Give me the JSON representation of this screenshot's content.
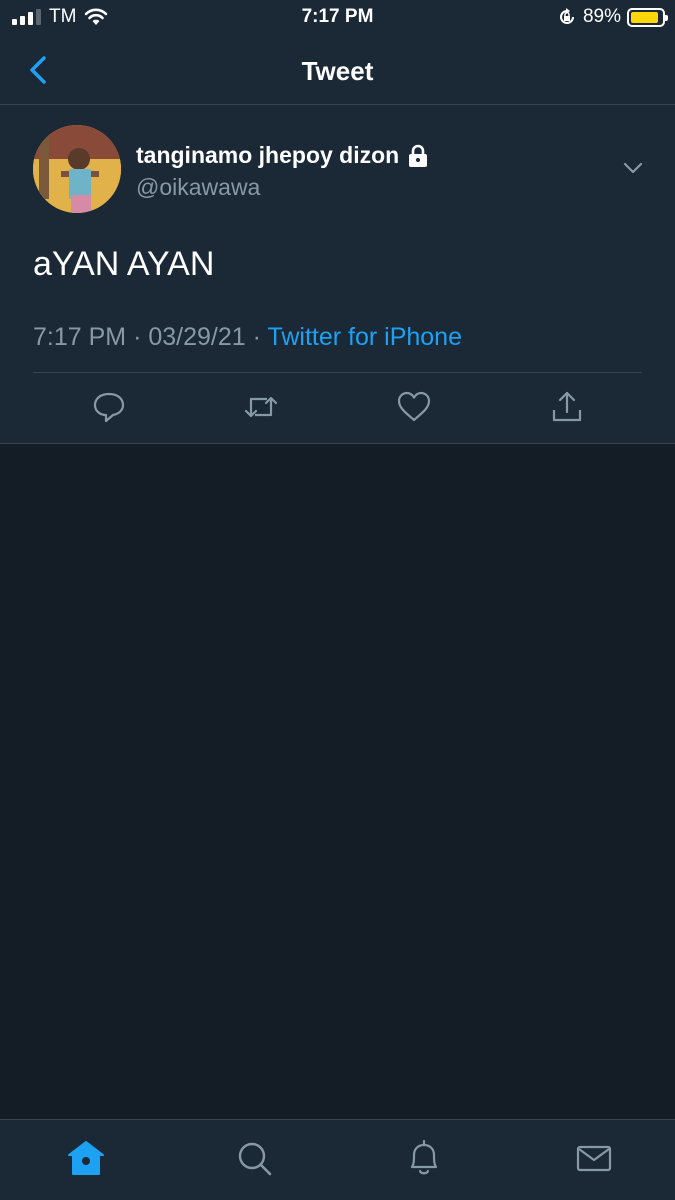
{
  "status_bar": {
    "carrier": "TM",
    "time": "7:17 PM",
    "battery_percent": "89%",
    "battery_level": 0.89,
    "signal_bars_filled": 3,
    "signal_bars_total": 4
  },
  "nav": {
    "title": "Tweet",
    "back_icon": "chevron-left-icon"
  },
  "tweet": {
    "display_name": "tanginamo jhepoy dizon",
    "protected_icon": "lock-icon",
    "handle": "@oikawawa",
    "text": "aYAN AYAN",
    "time": "7:17 PM",
    "separator": "·",
    "date": "03/29/21",
    "source": "Twitter for iPhone",
    "actions": [
      {
        "name": "reply",
        "icon": "reply-icon"
      },
      {
        "name": "retweet",
        "icon": "retweet-icon"
      },
      {
        "name": "like",
        "icon": "heart-icon"
      },
      {
        "name": "share",
        "icon": "share-icon"
      }
    ]
  },
  "tab_bar": {
    "tabs": [
      {
        "name": "home",
        "icon": "home-icon",
        "active": true
      },
      {
        "name": "search",
        "icon": "search-icon",
        "active": false
      },
      {
        "name": "notifications",
        "icon": "bell-icon",
        "active": false
      },
      {
        "name": "messages",
        "icon": "mail-icon",
        "active": false
      }
    ]
  },
  "colors": {
    "background": "#141d26",
    "surface": "#1b2836",
    "accent": "#1da1f2",
    "secondary_text": "#8899a6",
    "divider": "#38444d",
    "battery": "#ffd60a"
  }
}
